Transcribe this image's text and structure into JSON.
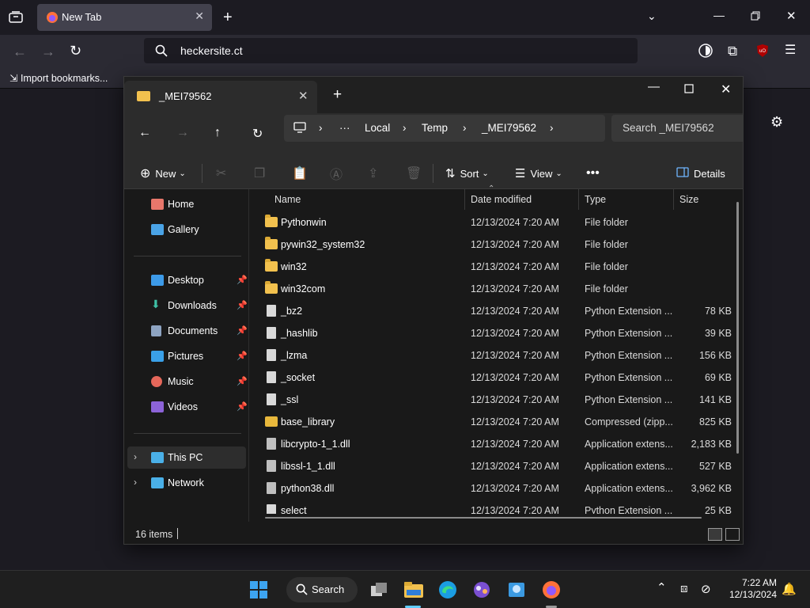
{
  "browser": {
    "tab_title": "New Tab",
    "url": "heckersite.ct",
    "bookmark_import": "Import bookmarks..."
  },
  "explorer": {
    "tab_title": "_MEI79562",
    "breadcrumb": [
      "Local",
      "Temp",
      "_MEI79562"
    ],
    "search_placeholder": "Search _MEI79562",
    "toolbar": {
      "new_label": "New",
      "sort_label": "Sort",
      "view_label": "View",
      "details_label": "Details"
    },
    "sidebar": {
      "home": "Home",
      "gallery": "Gallery",
      "desktop": "Desktop",
      "downloads": "Downloads",
      "documents": "Documents",
      "pictures": "Pictures",
      "music": "Music",
      "videos": "Videos",
      "this_pc": "This PC",
      "network": "Network"
    },
    "columns": {
      "name": "Name",
      "date": "Date modified",
      "type": "Type",
      "size": "Size"
    },
    "files": [
      {
        "name": "Pythonwin",
        "date": "12/13/2024 7:20 AM",
        "type": "File folder",
        "size": "",
        "icon": "folder"
      },
      {
        "name": "pywin32_system32",
        "date": "12/13/2024 7:20 AM",
        "type": "File folder",
        "size": "",
        "icon": "folder"
      },
      {
        "name": "win32",
        "date": "12/13/2024 7:20 AM",
        "type": "File folder",
        "size": "",
        "icon": "folder"
      },
      {
        "name": "win32com",
        "date": "12/13/2024 7:20 AM",
        "type": "File folder",
        "size": "",
        "icon": "folder"
      },
      {
        "name": "_bz2",
        "date": "12/13/2024 7:20 AM",
        "type": "Python Extension ...",
        "size": "78 KB",
        "icon": "pyd"
      },
      {
        "name": "_hashlib",
        "date": "12/13/2024 7:20 AM",
        "type": "Python Extension ...",
        "size": "39 KB",
        "icon": "pyd"
      },
      {
        "name": "_lzma",
        "date": "12/13/2024 7:20 AM",
        "type": "Python Extension ...",
        "size": "156 KB",
        "icon": "pyd"
      },
      {
        "name": "_socket",
        "date": "12/13/2024 7:20 AM",
        "type": "Python Extension ...",
        "size": "69 KB",
        "icon": "pyd"
      },
      {
        "name": "_ssl",
        "date": "12/13/2024 7:20 AM",
        "type": "Python Extension ...",
        "size": "141 KB",
        "icon": "pyd"
      },
      {
        "name": "base_library",
        "date": "12/13/2024 7:20 AM",
        "type": "Compressed (zipp...",
        "size": "825 KB",
        "icon": "zip"
      },
      {
        "name": "libcrypto-1_1.dll",
        "date": "12/13/2024 7:20 AM",
        "type": "Application extens...",
        "size": "2,183 KB",
        "icon": "dll"
      },
      {
        "name": "libssl-1_1.dll",
        "date": "12/13/2024 7:20 AM",
        "type": "Application extens...",
        "size": "527 KB",
        "icon": "dll"
      },
      {
        "name": "python38.dll",
        "date": "12/13/2024 7:20 AM",
        "type": "Application extens...",
        "size": "3,962 KB",
        "icon": "dll"
      },
      {
        "name": "select",
        "date": "12/13/2024 7:20 AM",
        "type": "Python Extension ...",
        "size": "25 KB",
        "icon": "pyd"
      }
    ],
    "status": "16 items"
  },
  "taskbar": {
    "search_label": "Search",
    "time": "7:22 AM",
    "date": "12/13/2024"
  }
}
